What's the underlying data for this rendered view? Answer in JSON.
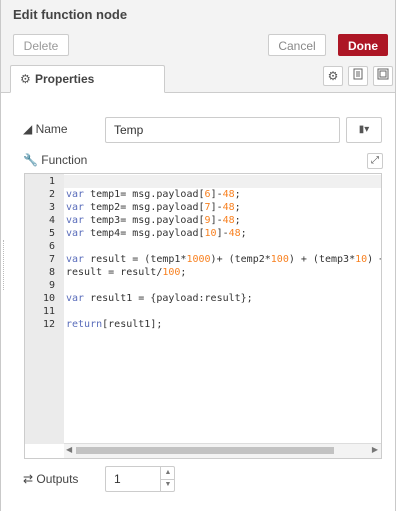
{
  "header": {
    "title": "Edit function node"
  },
  "toolbar": {
    "delete_label": "Delete",
    "cancel_label": "Cancel",
    "done_label": "Done"
  },
  "tabs": [
    {
      "label": "Properties",
      "icon": "gear-icon"
    }
  ],
  "tab_buttons": [
    "gear-icon",
    "document-icon",
    "layout-icon"
  ],
  "form": {
    "name_label": "Name",
    "name_value": "Temp",
    "function_label": "Function",
    "outputs_label": "Outputs",
    "outputs_value": "1"
  },
  "editor": {
    "line_numbers": [
      "1",
      "2",
      "3",
      "4",
      "5",
      "6",
      "7",
      "8",
      "9",
      "10",
      "11",
      "12"
    ],
    "lines": [
      "",
      "var temp1= msg.payload[6]-48;",
      "var temp2= msg.payload[7]-48;",
      "var temp3= msg.payload[9]-48;",
      "var temp4= msg.payload[10]-48;",
      "",
      "var result = (temp1*1000)+ (temp2*100) + (temp3*10) +",
      "result = result/100;",
      "",
      "var result1 = {payload:result};",
      "",
      "return[result1];"
    ]
  },
  "colors": {
    "done_button": "#ad1625",
    "keyword": "#5a6dbb",
    "number": "#f8801f"
  }
}
